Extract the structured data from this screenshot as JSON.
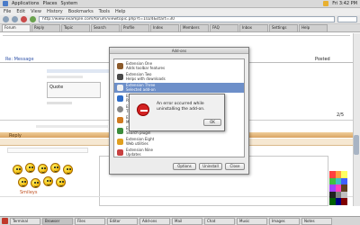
{
  "top_panel": {
    "items": [
      "Applications",
      "Places",
      "System"
    ],
    "clock": "Fri 3:42 PM"
  },
  "browser": {
    "menu": [
      "File",
      "Edit",
      "View",
      "History",
      "Bookmarks",
      "Tools",
      "Help"
    ],
    "url": "http://www.example.com/forum/viewtopic.php?t=1024&start=30",
    "tabs": [
      "Forum",
      "Reply",
      "Topic",
      "Search",
      "Profile",
      "Index",
      "Members",
      "FAQ",
      "Inbox",
      "Settings",
      "Help"
    ]
  },
  "page": {
    "header_left": "Re: Message",
    "header_right": "Posted",
    "quote": "Quote",
    "score": "2/5",
    "post_header": "Reply",
    "smileys_label": "Smileys"
  },
  "dialog": {
    "title": "Add-ons",
    "items": [
      {
        "line1": "Extension One",
        "line2": "Adds toolbar features"
      },
      {
        "line1": "Extension Two",
        "line2": "Helps with downloads"
      },
      {
        "line1": "Extension Three",
        "line2": "Selected add-on",
        "selected": true
      },
      {
        "line1": "Extension Four",
        "line2": "Page tools"
      },
      {
        "line1": "Extension Five",
        "line2": "Theme support"
      },
      {
        "line1": "Extension Six",
        "line2": "Mail helper"
      },
      {
        "line1": "Extension Seven",
        "line2": "Search plugin"
      },
      {
        "line1": "Extension Eight",
        "line2": "Web utilities"
      },
      {
        "line1": "Extension Nine",
        "line2": "Updates"
      }
    ],
    "buttons": [
      "Options",
      "Uninstall",
      "Close"
    ]
  },
  "alert": {
    "message_line1": "An error occurred while",
    "message_line2": "uninstalling the add-on.",
    "ok_label": "OK"
  },
  "taskbar": {
    "items": [
      "Terminal",
      "Browser",
      "Files",
      "Editor",
      "Add-ons",
      "Mail",
      "Chat",
      "Music",
      "Images",
      "Notes"
    ]
  },
  "colors": {
    "accent": "#6d8fc9",
    "alert_red": "#d32222",
    "bar_orange": "#d9a362"
  }
}
